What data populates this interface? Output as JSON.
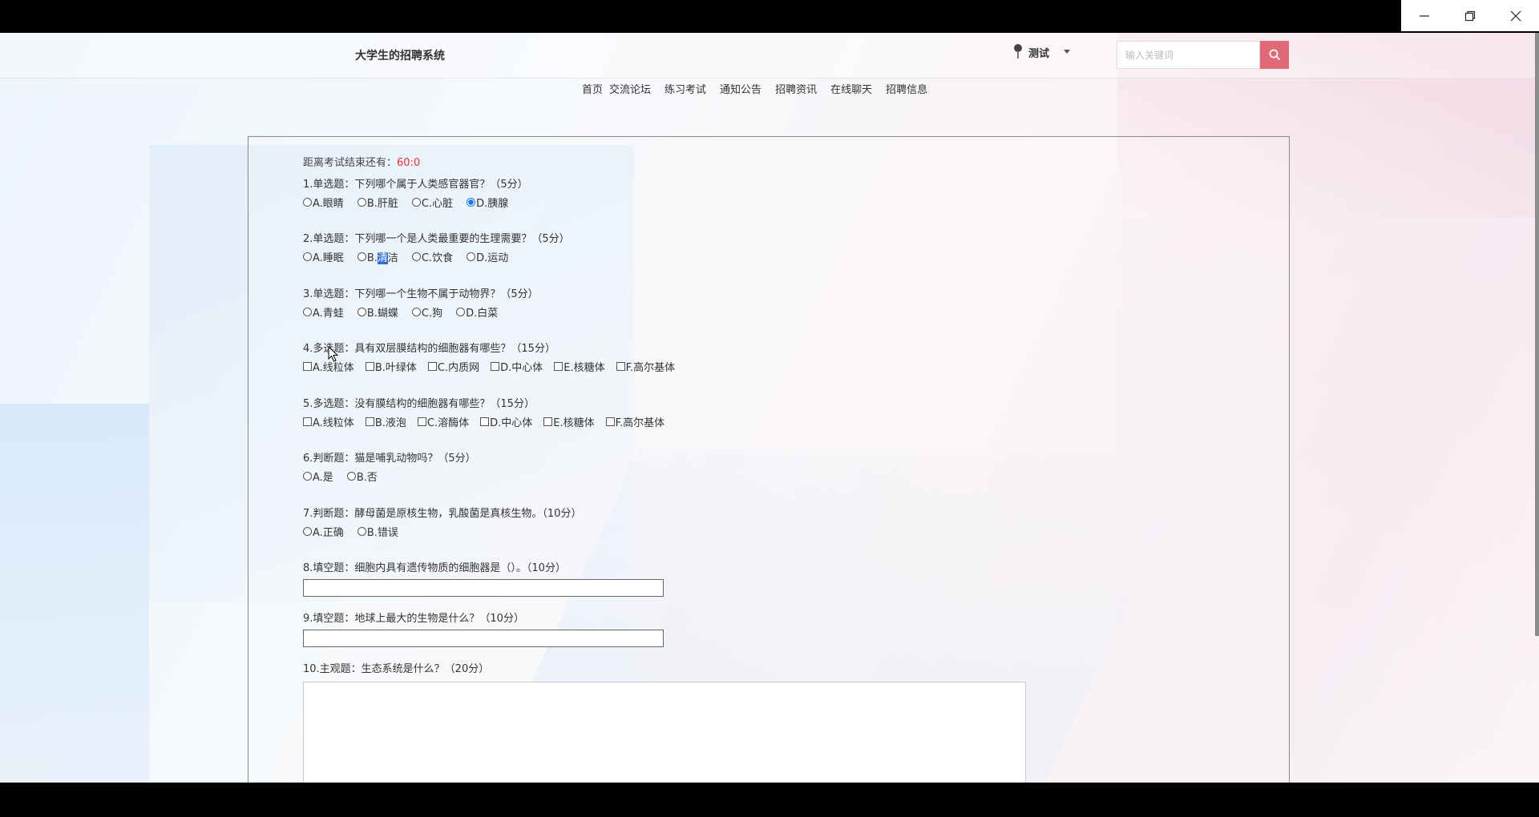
{
  "site": {
    "title": "大学生的招聘系统"
  },
  "user": {
    "name": "测试"
  },
  "search": {
    "placeholder": "输入关键词"
  },
  "nav": [
    "首页",
    "交流论坛",
    "练习考试",
    "通知公告",
    "招聘资讯",
    "在线聊天",
    "招聘信息"
  ],
  "exam": {
    "timer_label": "距离考试结束还有：",
    "timer_value": "60:0",
    "questions": [
      {
        "text": "1.单选题：下列哪个属于人类感官器官？（5分）",
        "type": "radio",
        "options": [
          "A.眼睛",
          "B.肝脏",
          "C.心脏",
          "D.胰腺"
        ],
        "selected": 3
      },
      {
        "text": "2.单选题：下列哪一个是人类最重要的生理需要？（5分）",
        "type": "radio",
        "options": [
          "A.睡眠",
          "B.清洁",
          "C.饮食",
          "D.运动"
        ],
        "selected": null
      },
      {
        "text": "3.单选题：下列哪一个生物不属于动物界？（5分）",
        "type": "radio",
        "options": [
          "A.青蛙",
          "B.蝴蝶",
          "C.狗",
          "D.白菜"
        ],
        "selected": null
      },
      {
        "text": "4.多选题：具有双层膜结构的细胞器有哪些？（15分）",
        "type": "checkbox",
        "options": [
          "A.线粒体",
          "B.叶绿体",
          "C.内质网",
          "D.中心体",
          "E.核糖体",
          "F.高尔基体"
        ]
      },
      {
        "text": "5.多选题：没有膜结构的细胞器有哪些？（15分）",
        "type": "checkbox",
        "options": [
          "A.线粒体",
          "B.液泡",
          "C.溶酶体",
          "D.中心体",
          "E.核糖体",
          "F.高尔基体"
        ]
      },
      {
        "text": "6.判断题：猫是哺乳动物吗？（5分）",
        "type": "radio",
        "options": [
          "A.是",
          "B.否"
        ],
        "selected": null
      },
      {
        "text": "7.判断题：酵母菌是原核生物，乳酸菌是真核生物。（10分）",
        "type": "radio",
        "options": [
          "A.正确",
          "B.错误"
        ],
        "selected": null
      },
      {
        "text": "8.填空题：细胞内具有遗传物质的细胞器是（）。（10分）",
        "type": "fill",
        "value": ""
      },
      {
        "text": "9.填空题：地球上最大的生物是什么？（10分）",
        "type": "fill",
        "value": ""
      },
      {
        "text": "10.主观题：生态系统是什么？（20分）",
        "type": "essay",
        "value": ""
      }
    ]
  },
  "colors": {
    "accent": "#e26a78",
    "timer": "#e33333",
    "selection": "#2f6fd0"
  },
  "icons": {
    "search": "search-icon",
    "avatar": "user-avatar-icon",
    "caret": "caret-down-icon"
  }
}
